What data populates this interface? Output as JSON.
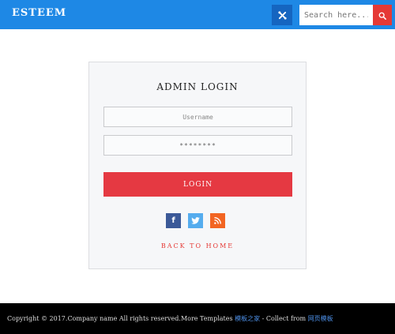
{
  "header": {
    "logo": "ESTEEM",
    "toggle_icon": "tools-icon",
    "search_placeholder": "Search here...",
    "search_icon": "search-icon"
  },
  "login": {
    "title": "ADMIN LOGIN",
    "username_placeholder": "Username",
    "password_value": "********",
    "button_label": "LOGIN",
    "back_label": "BACK TO HOME"
  },
  "social": [
    {
      "name": "facebook-icon",
      "glyph": "f"
    },
    {
      "name": "twitter-icon",
      "glyph": "t"
    },
    {
      "name": "rss-icon",
      "glyph": "rss"
    }
  ],
  "footer": {
    "copyright": "Copyright © 2017.Company name All rights reserved.More Templates ",
    "link1": "模板之家",
    "middle": " - Collect from ",
    "link2": "网页模板"
  },
  "colors": {
    "header_bg": "#1e88e5",
    "accent_red": "#e53935",
    "facebook": "#3b5998",
    "twitter": "#55acee",
    "rss": "#f26522",
    "link_blue": "#4d8fe6"
  }
}
